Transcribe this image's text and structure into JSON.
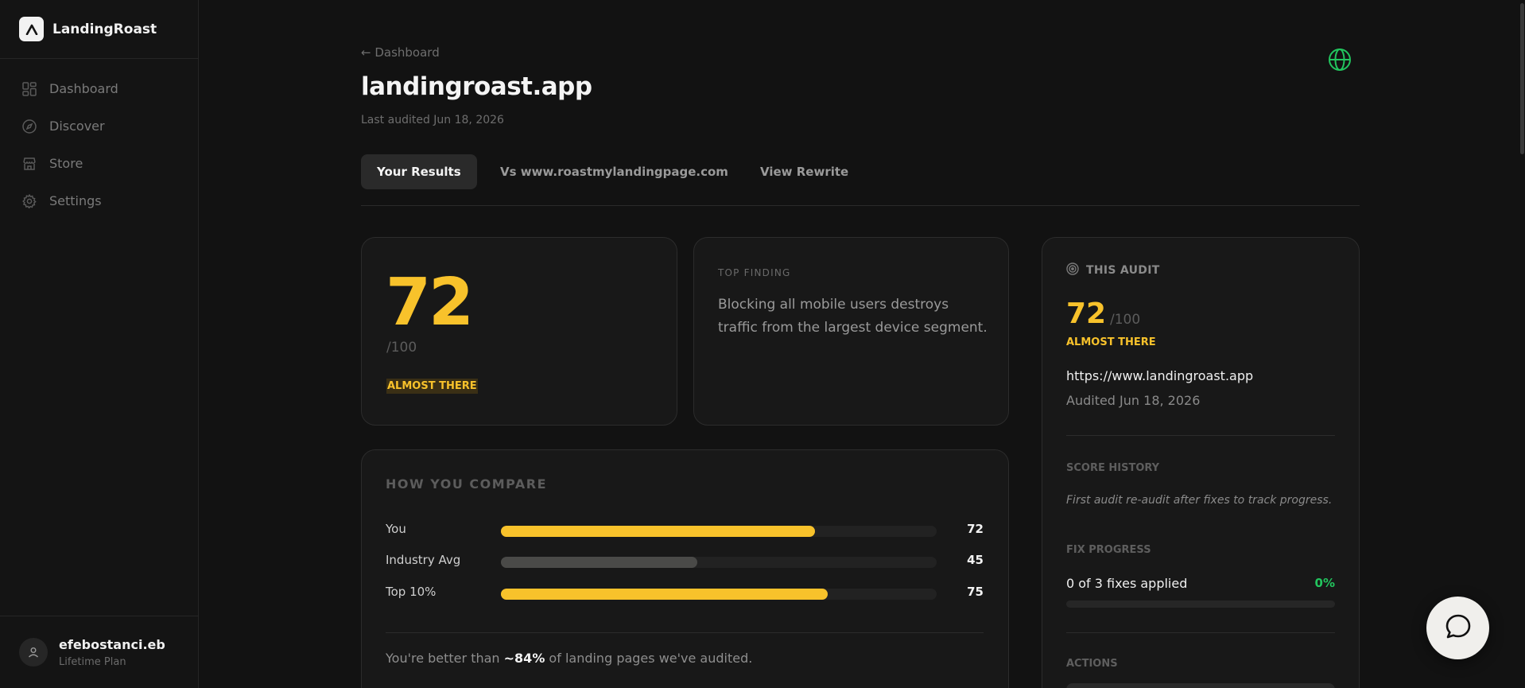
{
  "app": {
    "name": "LandingRoast"
  },
  "sidebar": {
    "items": [
      {
        "label": "Dashboard",
        "icon": "dashboard-icon"
      },
      {
        "label": "Discover",
        "icon": "compass-icon"
      },
      {
        "label": "Store",
        "icon": "store-icon"
      },
      {
        "label": "Settings",
        "icon": "gear-icon"
      }
    ],
    "user": {
      "name": "efebostanci.eb",
      "plan": "Lifetime Plan"
    }
  },
  "header": {
    "back_link": "← Dashboard",
    "title": "landingroast.app",
    "subtitle": "Last audited Jun 18, 2026"
  },
  "tabs": [
    {
      "label": "Your Results",
      "active": true
    },
    {
      "label": "Vs www.roastmylandingpage.com",
      "active": false
    },
    {
      "label": "View Rewrite",
      "active": false
    }
  ],
  "score_card": {
    "score": "72",
    "out_of": "/100",
    "badge": "ALMOST THERE"
  },
  "top_finding": {
    "label": "TOP FINDING",
    "text": "Blocking all mobile users destroys traffic from the largest device segment."
  },
  "compare": {
    "title": "HOW YOU COMPARE",
    "rows": [
      {
        "label": "You",
        "value": "72",
        "fraction": 0.72,
        "color": "#f8c22b"
      },
      {
        "label": "Industry Avg",
        "value": "45",
        "fraction": 0.45,
        "color": "#4a4a48"
      },
      {
        "label": "Top 10%",
        "value": "75",
        "fraction": 0.75,
        "color": "#f8c22b"
      }
    ],
    "footer_pre": "You're better than ",
    "footer_bold": "~84%",
    "footer_post": " of landing pages we've audited."
  },
  "this_audit": {
    "label": "THIS AUDIT",
    "score": "72",
    "out_of": "/100",
    "badge": "ALMOST THERE",
    "url": "https://www.landingroast.app",
    "audited": "Audited Jun 18, 2026",
    "history_label": "SCORE HISTORY",
    "history_text": "First audit re-audit after fixes to track progress.",
    "fix_label": "FIX PROGRESS",
    "fix_text": "0 of 3 fixes applied",
    "fix_percent": "0%",
    "fix_fraction": 0,
    "actions_label": "ACTIONS"
  },
  "colors": {
    "accent": "#f8c22b",
    "success": "#22c55e",
    "background": "#121212"
  }
}
